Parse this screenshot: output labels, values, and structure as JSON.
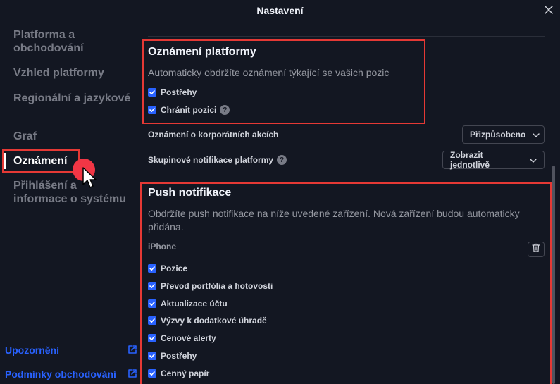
{
  "window": {
    "title": "Nastavení"
  },
  "sidebar": {
    "items": [
      {
        "label": "Platforma a obchodování"
      },
      {
        "label": "Vzhled platformy"
      },
      {
        "label": "Regionální a jazykové"
      },
      {
        "label": "Graf"
      },
      {
        "label": "Oznámení"
      },
      {
        "label": "Přihlášení a informace o systému"
      }
    ],
    "active": "Oznámení",
    "footer_links": [
      {
        "label": "Upozornění"
      },
      {
        "label": "Podmínky obchodování"
      }
    ]
  },
  "platform_notifications": {
    "title": "Oznámení platformy",
    "description": "Automaticky obdržíte oznámení týkající se vašich pozic",
    "options": [
      {
        "label": "Postřehy",
        "checked": true
      },
      {
        "label": "Chránit pozici",
        "checked": true
      }
    ]
  },
  "settings": {
    "corporate_actions": {
      "label": "Oznámení o korporátních akcích",
      "value": "Přizpůsobeno"
    },
    "group_notifications": {
      "label": "Skupinové notifikace platformy",
      "value": "Zobrazit jednotlivě"
    }
  },
  "push_notifications": {
    "title": "Push notifikace",
    "description": "Obdržíte push notifikace na níže uvedené zařízení. Nová zařízení budou automaticky přidána.",
    "device": "iPhone",
    "options": [
      {
        "label": "Pozice",
        "checked": true
      },
      {
        "label": "Převod portfólia a hotovosti",
        "checked": true
      },
      {
        "label": "Aktualizace účtu",
        "checked": true
      },
      {
        "label": "Výzvy k dodatkové úhradě",
        "checked": true
      },
      {
        "label": "Cenové alerty",
        "checked": true
      },
      {
        "label": "Postřehy",
        "checked": true
      },
      {
        "label": "Cenný papír",
        "checked": true
      }
    ]
  },
  "colors": {
    "background": "#131722",
    "accent": "#2962ff",
    "highlight": "#e53935",
    "cursor_dot": "#f23645"
  },
  "icons": {
    "close": "close-icon",
    "help": "help-icon",
    "chevron": "chevron-down-icon",
    "trash": "trash-icon",
    "external": "external-link-icon",
    "cursor": "mouse-pointer-icon"
  }
}
